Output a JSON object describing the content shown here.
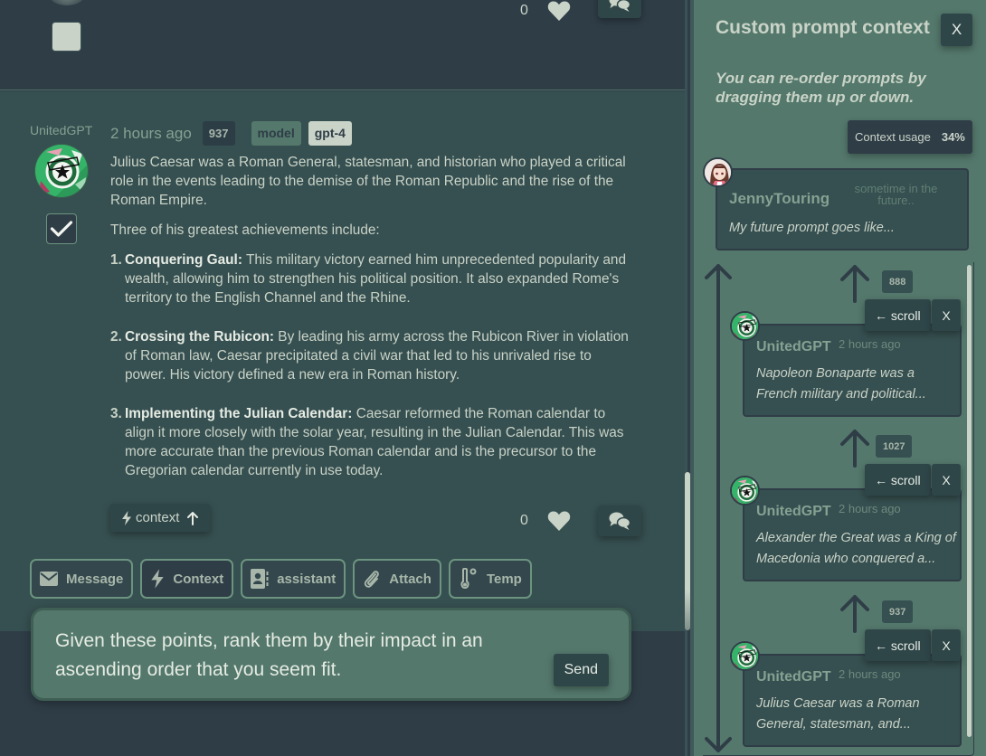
{
  "previous_message": {
    "likes": "0"
  },
  "message": {
    "author": "UnitedGPT",
    "time": "2 hours ago",
    "tokens": "937",
    "model_label": "model",
    "model_value": "gpt-4",
    "intro": "Julius Caesar was a Roman General, statesman, and historian who played a critical role in the events leading to the demise of the Roman Republic and the rise of the Roman Empire.",
    "lead": "Three of his greatest achievements include:",
    "points": [
      {
        "num": "1.",
        "title": "Conquering Gaul:",
        "text": " This military victory earned him unprecedented popularity and wealth, allowing him to strengthen his political position. It also expanded Rome's territory to the English Channel and the Rhine."
      },
      {
        "num": "2.",
        "title": "Crossing the Rubicon:",
        "text": " By leading his army across the Rubicon River in violation of Roman law, Caesar precipitated a civil war that led to his unrivaled rise to power. His victory defined a new era in Roman history."
      },
      {
        "num": "3.",
        "title": "Implementing the Julian Calendar:",
        "text": " Caesar reformed the Roman calendar to align it more closely with the solar year, resulting in the Julian Calendar. This was more accurate than the previous Roman calendar and is the precursor to the Gregorian calendar currently in use today."
      }
    ],
    "context_button": "context",
    "likes": "0"
  },
  "toolbar": {
    "message": "Message",
    "context": "Context",
    "assistant": "assistant",
    "attach": "Attach",
    "temp": "Temp"
  },
  "composer": {
    "value": "Given these points, rank them by their impact in an ascending order that you seem fit.",
    "send": "Send"
  },
  "panel": {
    "title": "Custom prompt context",
    "close": "X",
    "hint": "You can re-order prompts by dragging them up or down.",
    "usage_label": "Context usage",
    "usage_value": "34%",
    "future": {
      "author": "JennyTouring",
      "time": "sometime in the future..",
      "text": "My future prompt goes like..."
    },
    "items": [
      {
        "tokens": "888",
        "scroll": "← scroll",
        "remove": "X",
        "author": "UnitedGPT",
        "time": "2 hours ago",
        "text": "Napoleon Bonaparte was a French military and political..."
      },
      {
        "tokens": "1027",
        "scroll": "← scroll",
        "remove": "X",
        "author": "UnitedGPT",
        "time": "2 hours ago",
        "text": "Alexander the Great was a King of Macedonia who conquered a..."
      },
      {
        "tokens": "937",
        "scroll": "← scroll",
        "remove": "X",
        "author": "UnitedGPT",
        "time": "2 hours ago",
        "text": "Julius Caesar was a Roman General, statesman, and..."
      }
    ]
  }
}
